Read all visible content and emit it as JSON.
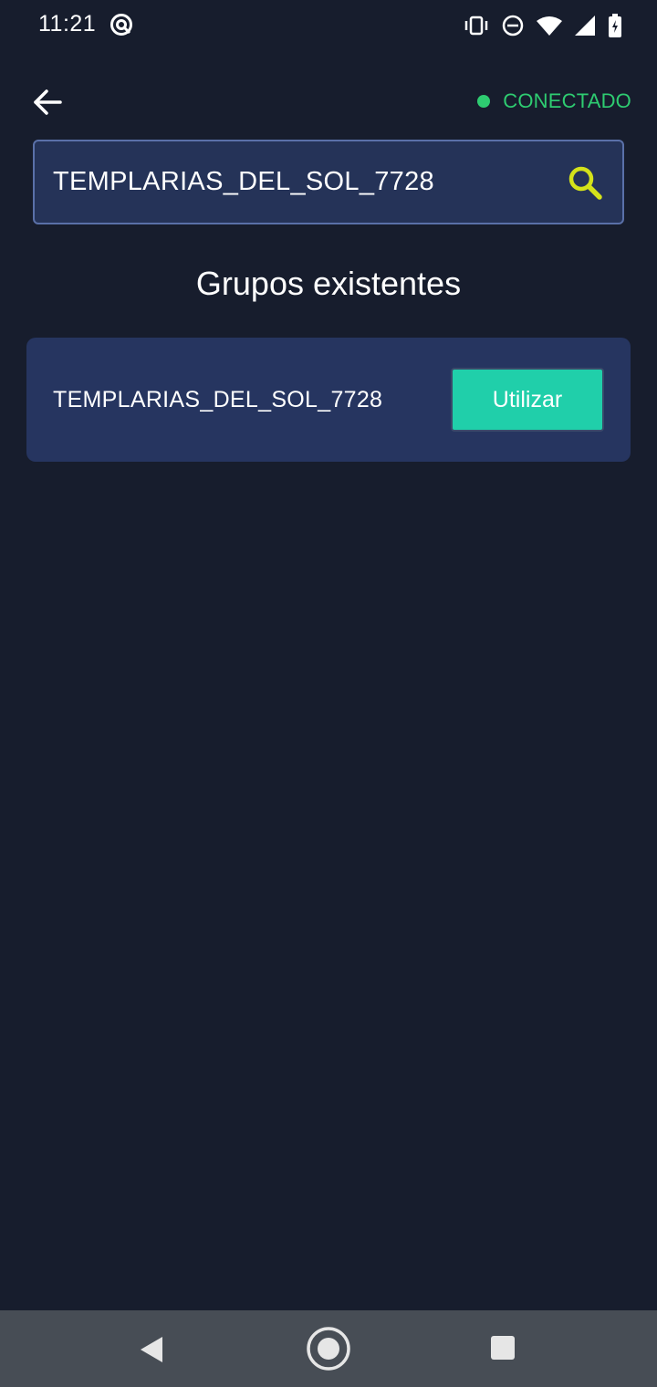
{
  "status_bar": {
    "time": "11:21"
  },
  "header": {
    "back_icon": "arrow-left-icon",
    "connection_status": "CONECTADO"
  },
  "search": {
    "value": "TEMPLARIAS_DEL_SOL_7728",
    "icon": "search-icon"
  },
  "section": {
    "title": "Grupos existentes"
  },
  "groups": [
    {
      "name": "TEMPLARIAS_DEL_SOL_7728",
      "action_label": "Utilizar"
    }
  ],
  "colors": {
    "background": "#171d2d",
    "card": "#263560",
    "accent_button": "#20cfaa",
    "connected": "#2ecc71",
    "search_icon": "#d4e21a"
  }
}
